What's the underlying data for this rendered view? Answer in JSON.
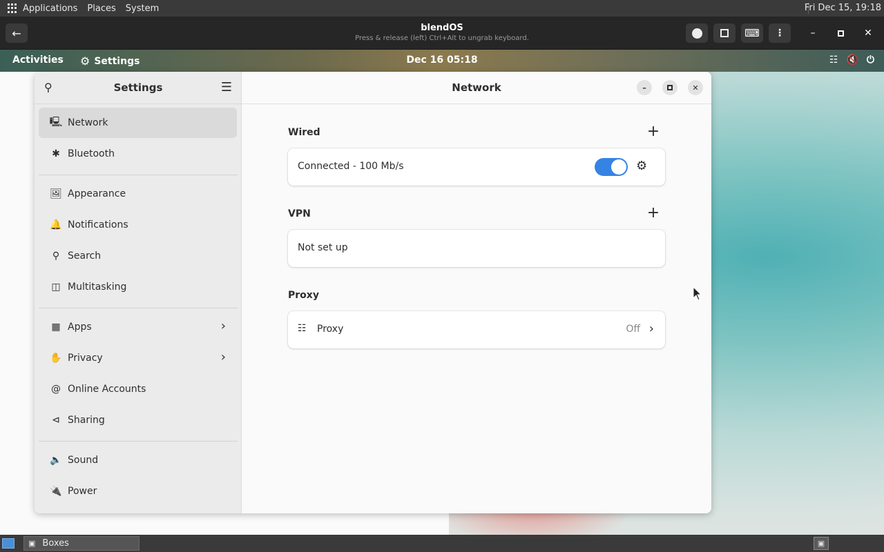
{
  "host_topbar": {
    "menus": [
      "Applications",
      "Places",
      "System"
    ],
    "clock": "Fri Dec 15, 19:18"
  },
  "boxes_header": {
    "title": "blendOS",
    "subtitle": "Press & release (left) Ctrl+Alt to ungrab keyboard."
  },
  "gnome_topbar": {
    "activities": "Activities",
    "app_name": "Settings",
    "datetime": "Dec 16  05:18"
  },
  "sidebar": {
    "title": "Settings",
    "items": [
      {
        "label": "Network",
        "icon": "network-icon"
      },
      {
        "label": "Bluetooth",
        "icon": "bluetooth-icon"
      },
      {
        "label": "Appearance",
        "icon": "appearance-icon"
      },
      {
        "label": "Notifications",
        "icon": "bell-icon"
      },
      {
        "label": "Search",
        "icon": "search-icon"
      },
      {
        "label": "Multitasking",
        "icon": "multitasking-icon"
      },
      {
        "label": "Apps",
        "icon": "apps-icon"
      },
      {
        "label": "Privacy",
        "icon": "hand-icon"
      },
      {
        "label": "Online Accounts",
        "icon": "at-icon"
      },
      {
        "label": "Sharing",
        "icon": "share-icon"
      },
      {
        "label": "Sound",
        "icon": "speaker-icon"
      },
      {
        "label": "Power",
        "icon": "power-icon"
      }
    ]
  },
  "content": {
    "title": "Network",
    "wired": {
      "label": "Wired",
      "status": "Connected - 100 Mb/s",
      "enabled": true
    },
    "vpn": {
      "label": "VPN",
      "status": "Not set up"
    },
    "proxy": {
      "label": "Proxy",
      "row_label": "Proxy",
      "value": "Off"
    }
  },
  "taskbar": {
    "task_label": "Boxes"
  },
  "colors": {
    "accent": "#3584e4"
  }
}
